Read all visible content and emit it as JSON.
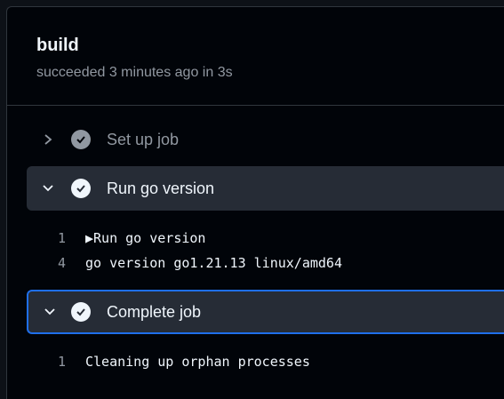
{
  "job": {
    "title": "build",
    "status": "succeeded 3 minutes ago in 3s"
  },
  "colors": {
    "accent": "#1f6feb",
    "row_bg": "#262c36"
  },
  "steps": [
    {
      "label": "Set up job",
      "expanded": false,
      "icon": "check-circle-icon"
    },
    {
      "label": "Run go version",
      "expanded": true,
      "icon": "check-circle-icon",
      "log": [
        {
          "n": "1",
          "text": "▶Run go version"
        },
        {
          "n": "4",
          "text": "go version go1.21.13 linux/amd64"
        }
      ]
    },
    {
      "label": "Complete job",
      "expanded": true,
      "focused": true,
      "icon": "check-circle-icon",
      "log": [
        {
          "n": "1",
          "text": "Cleaning up orphan processes"
        }
      ]
    }
  ]
}
